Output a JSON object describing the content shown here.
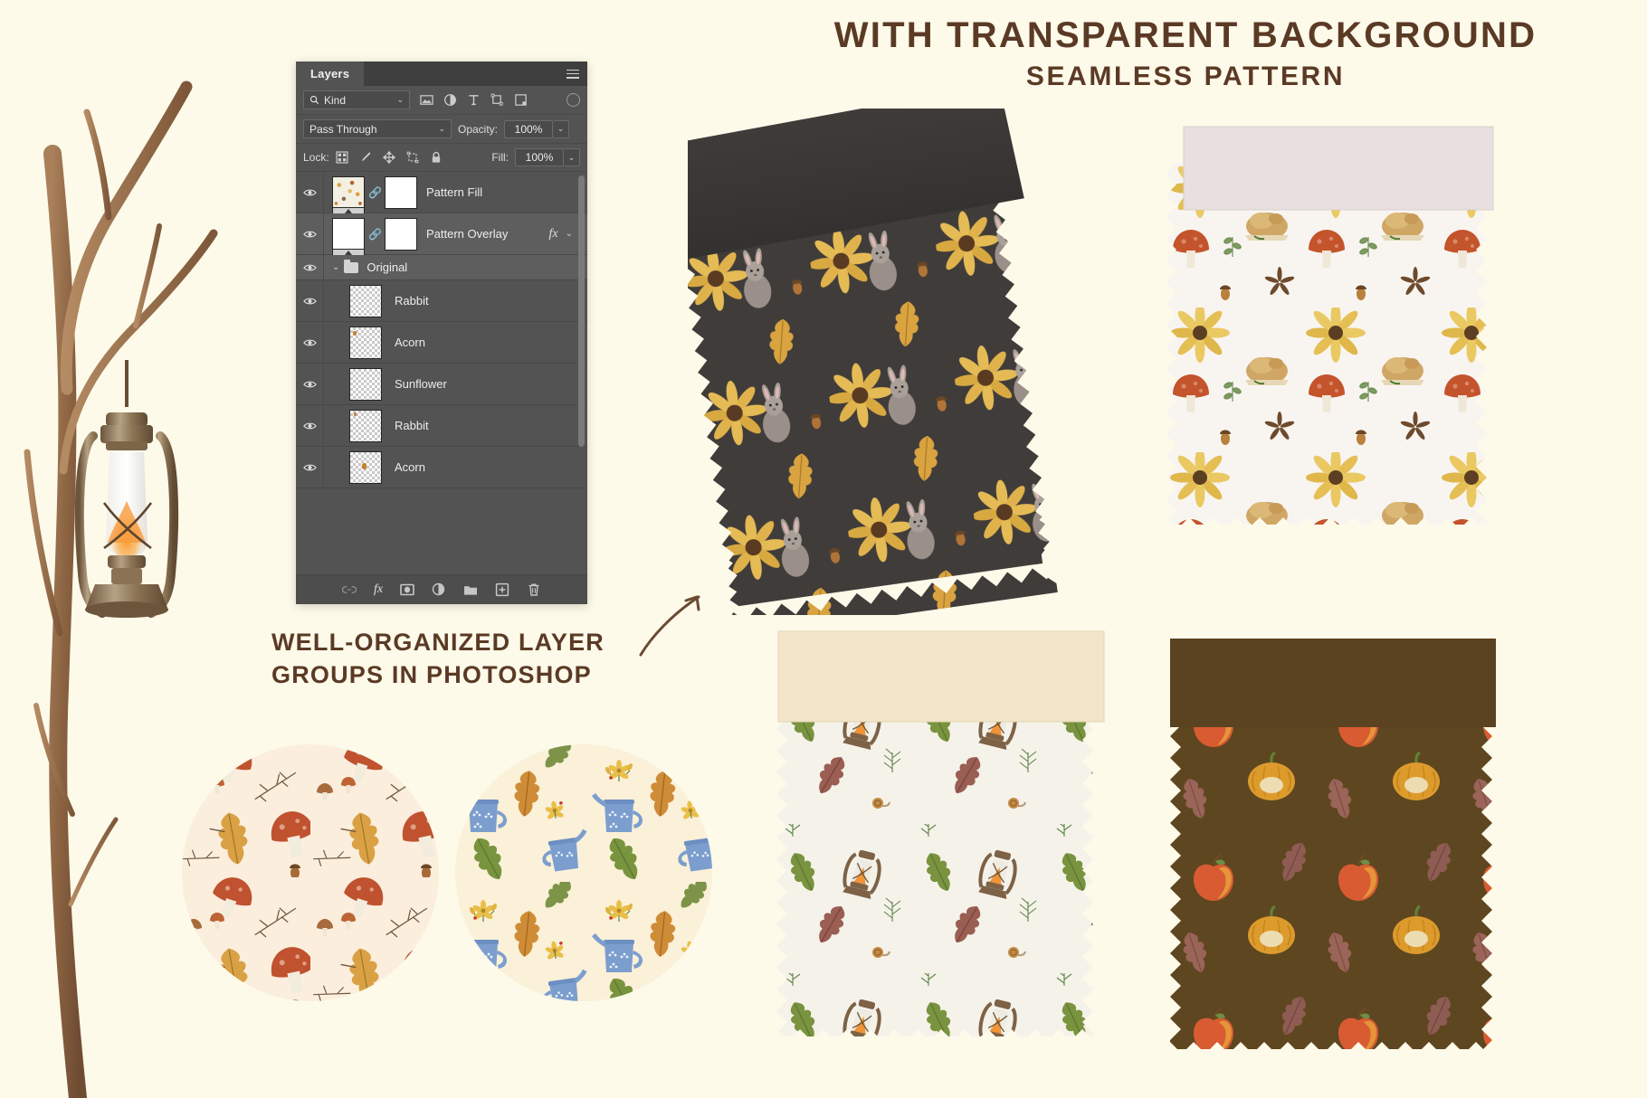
{
  "page": {
    "background_color": "#fdfaea",
    "heading": "WITH TRANSPARENT BACKGROUND",
    "subheading": "SEAMLESS PATTERN",
    "caption_line1": "WELL-ORGANIZED LAYER",
    "caption_line2": "GROUPS IN PHOTOSHOP",
    "heading_color": "#5b3a25"
  },
  "photoshop_panel": {
    "tab_label": "Layers",
    "panel_menu_icon": "hamburger-menu-icon",
    "filter": {
      "kind_label": "Kind",
      "search_icon": "search-icon",
      "chevron": "⌄",
      "icons": [
        "image-filter-icon",
        "adjustment-filter-icon",
        "type-filter-icon",
        "shape-filter-icon",
        "smartobject-filter-icon"
      ],
      "toggle_icon": "filter-toggle-icon"
    },
    "blend": {
      "mode": "Pass Through",
      "opacity_label": "Opacity:",
      "opacity_value": "100%",
      "chevron": "⌄"
    },
    "lock": {
      "label": "Lock:",
      "icons": [
        "lock-transparency-icon",
        "lock-image-icon",
        "lock-position-icon",
        "lock-artboard-icon",
        "lock-all-icon"
      ],
      "fill_label": "Fill:",
      "fill_value": "100%"
    },
    "layers": [
      {
        "name": "Pattern Fill",
        "type": "fill",
        "thumb": "pattern",
        "visible": true,
        "selected": false,
        "has_link": true,
        "has_mask": true,
        "fx": false
      },
      {
        "name": "Pattern Overlay",
        "type": "fill",
        "thumb": "white",
        "visible": true,
        "selected": true,
        "has_link": true,
        "has_mask": true,
        "fx": true,
        "fx_label": "fx",
        "fx_chevron": "⌄"
      },
      {
        "name": "Original",
        "type": "group",
        "visible": true,
        "selected": true,
        "chevron": "⌄",
        "folder_icon": "folder-icon"
      },
      {
        "name": "Rabbit",
        "type": "layer",
        "thumb": "checker",
        "visible": true,
        "selected": false
      },
      {
        "name": "Acorn",
        "type": "layer",
        "thumb": "checker",
        "visible": true,
        "selected": false
      },
      {
        "name": "Sunflower",
        "type": "layer",
        "thumb": "checker",
        "visible": true,
        "selected": false
      },
      {
        "name": "Rabbit",
        "type": "layer",
        "thumb": "checker",
        "visible": true,
        "selected": false
      },
      {
        "name": "Acorn",
        "type": "layer",
        "thumb": "checker",
        "visible": true,
        "selected": false
      }
    ],
    "footer_icons": [
      "link-layers-icon",
      "add-layer-style-icon",
      "add-layer-mask-icon",
      "new-adjustment-layer-icon",
      "new-group-icon",
      "new-layer-icon",
      "delete-layer-icon"
    ],
    "footer_fx_label": "fx",
    "colors": {
      "panel_bg": "#535353",
      "panel_header": "#3f3f3f",
      "row_selected": "#5e5e5e",
      "footer_bg": "#4d4d4d",
      "text": "#ededed"
    }
  },
  "decor": {
    "branch_label": "watercolor-branch",
    "lantern_label": "watercolor-lantern",
    "arrow_label": "curved-arrow"
  },
  "swatches": [
    {
      "id": "swatch-dark-rabbit",
      "tag_color": "#3a3736",
      "fabric_color": "#403c3a",
      "motifs": [
        "rabbit",
        "sunflower",
        "oak-leaf",
        "acorn"
      ]
    },
    {
      "id": "swatch-white-mushroom",
      "tag_color": "#e8dfdf",
      "fabric_color": "#f7f4f0",
      "motifs": [
        "mushroom",
        "sunflower",
        "roast-turkey",
        "star-anise",
        "acorn",
        "berries"
      ]
    },
    {
      "id": "swatch-cream-lantern",
      "tag_color": "#f2e5c8",
      "fabric_color": "#f5f2ea",
      "motifs": [
        "lantern",
        "oak-leaf",
        "pine-sprig",
        "snail"
      ]
    },
    {
      "id": "swatch-brown-pumpkin",
      "tag_color": "#5b4220",
      "fabric_color": "#5e4620",
      "motifs": [
        "apple",
        "pumpkin",
        "oak-leaf"
      ]
    }
  ],
  "circles": [
    {
      "id": "circle-mushroom-pattern",
      "bg_color": "#fbeedd",
      "motifs": [
        "mushroom",
        "oak-leaf",
        "twig",
        "acorn"
      ]
    },
    {
      "id": "circle-teapot-pattern",
      "bg_color": "#fbf0d8",
      "motifs": [
        "blue-teapot",
        "yellow-flower",
        "oak-leaf"
      ]
    }
  ]
}
